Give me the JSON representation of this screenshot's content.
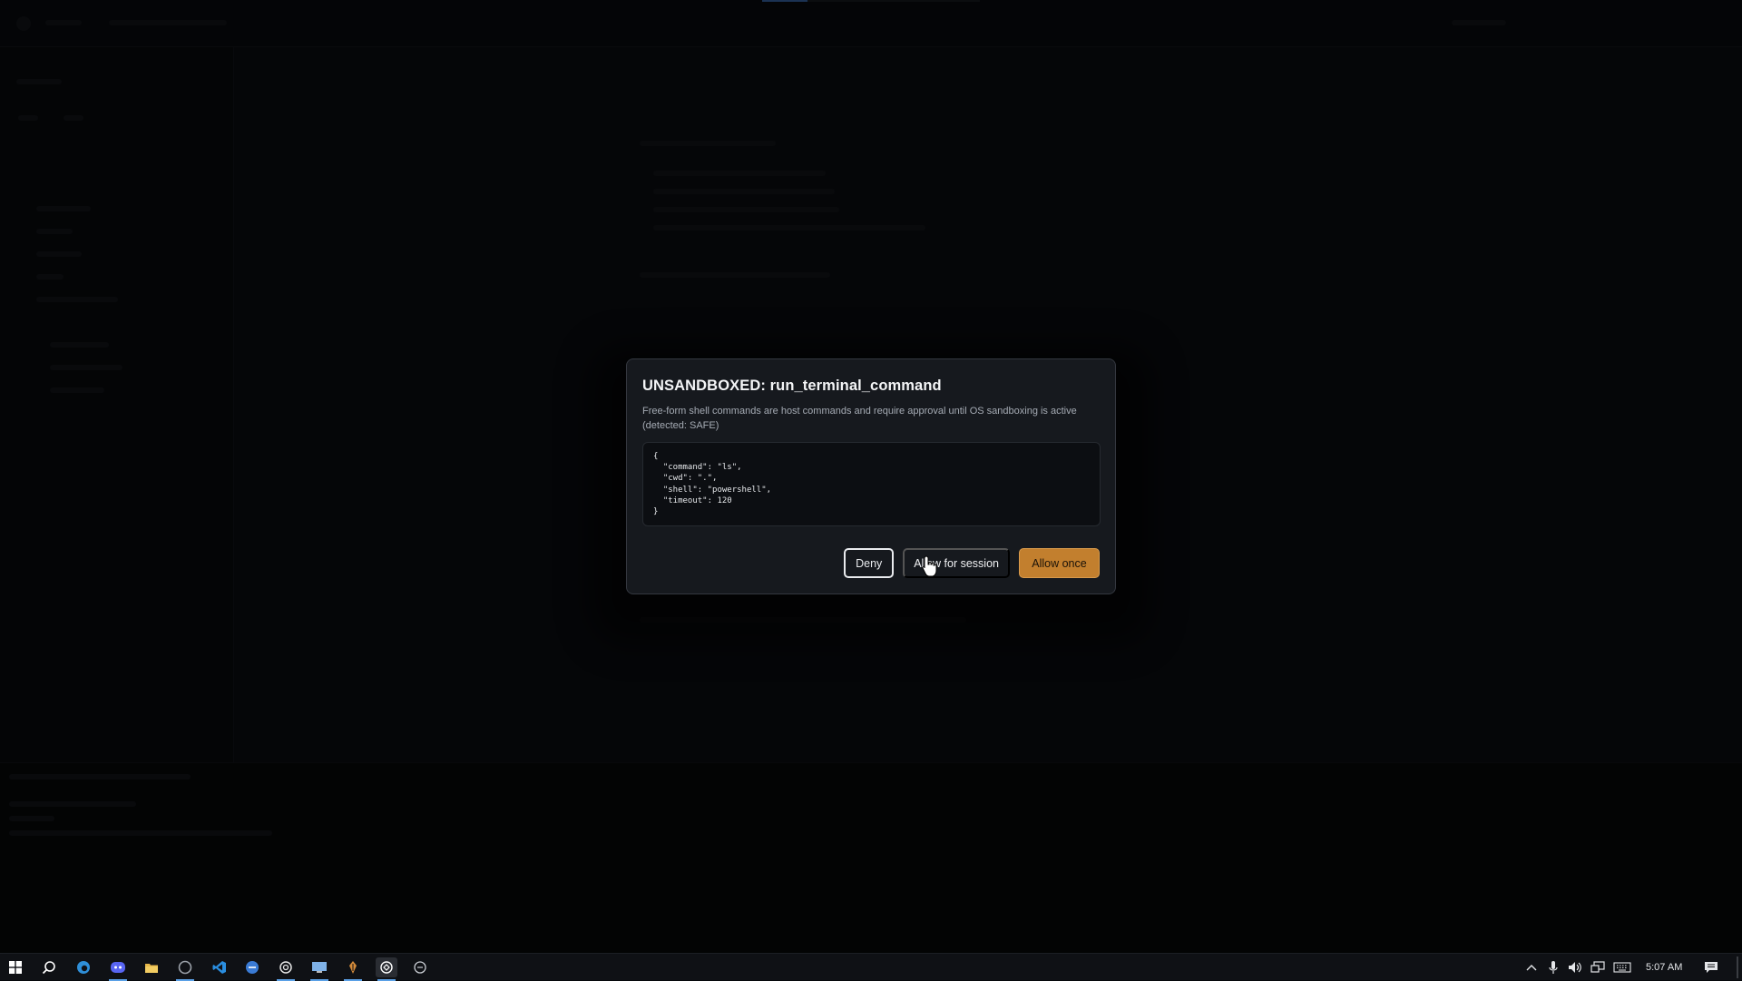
{
  "dialog": {
    "title": "UNSANDBOXED: run_terminal_command",
    "description": "Free-form shell commands are host commands and require approval until OS sandboxing is active (detected: SAFE)",
    "code_lines": [
      "{",
      "  \"command\": \"ls\",",
      "  \"cwd\": \".\",",
      "  \"shell\": \"powershell\",",
      "  \"timeout\": 120",
      "}"
    ],
    "buttons": {
      "deny": "Deny",
      "allow_session": "Allow for session",
      "allow_once": "Allow once"
    }
  },
  "taskbar": {
    "clock": "5:07 AM",
    "icons": [
      "windows-start",
      "search",
      "edge",
      "discord",
      "file-explorer",
      "app-circle",
      "vscode",
      "browser-blue",
      "chatgpt",
      "remote-desktop",
      "pen-tool",
      "app-active",
      "app-outline"
    ]
  },
  "colors": {
    "accent": "#c27f2e",
    "dialog_bg": "#16191e",
    "backdrop": "#0c0e12"
  }
}
